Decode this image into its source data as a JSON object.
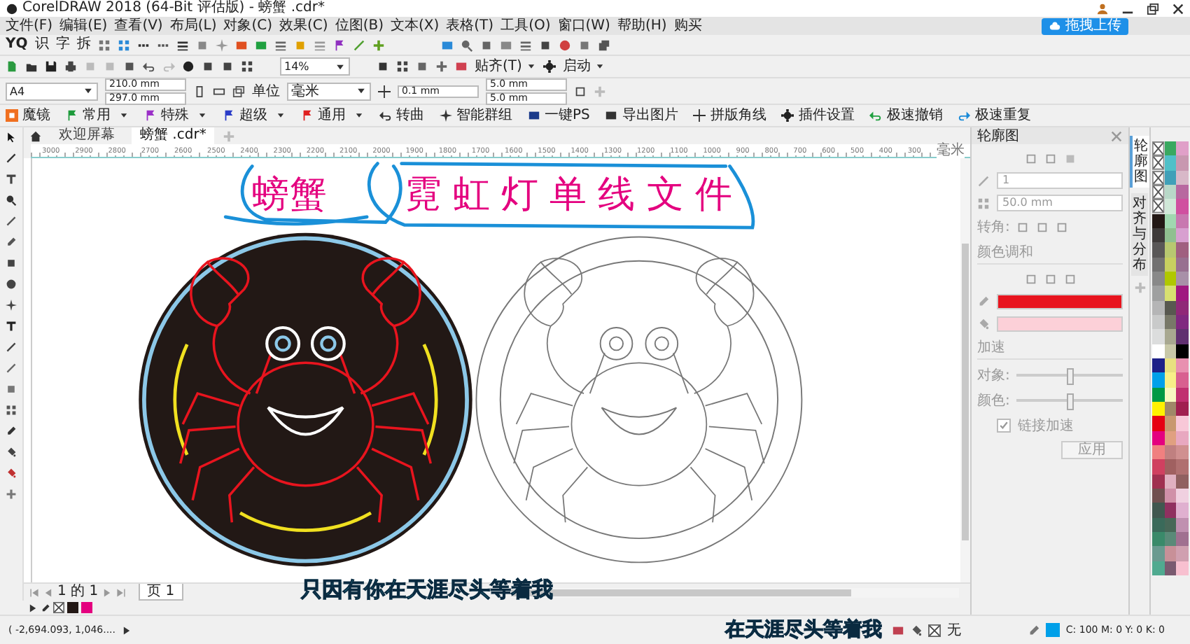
{
  "window": {
    "title": "CorelDRAW 2018 (64-Bit 评估版) - 螃蟹 .cdr*"
  },
  "menu": [
    "文件(F)",
    "编辑(E)",
    "查看(V)",
    "布局(L)",
    "对象(C)",
    "效果(C)",
    "位图(B)",
    "文本(X)",
    "表格(T)",
    "工具(O)",
    "窗口(W)",
    "帮助(H)",
    "购买"
  ],
  "upload_button": "拖拽上传",
  "text_tools": [
    "YQ",
    "识",
    "字",
    "拆"
  ],
  "standard_toolbar": {
    "zoom": "14%",
    "snap": "贴齐(T)",
    "launch": "启动"
  },
  "property_bar": {
    "page_size": "A4",
    "width": "210.0 mm",
    "height": "297.0 mm",
    "units_label": "单位",
    "units": "毫米",
    "nudge": "0.1 mm",
    "dup_x": "5.0 mm",
    "dup_y": "5.0 mm"
  },
  "plugin_bar": [
    {
      "kind": "app",
      "label": "魔镜"
    },
    {
      "kind": "menu",
      "label": "常用",
      "color": "#1e9b3c"
    },
    {
      "kind": "menu",
      "label": "特殊",
      "color": "#9b30c8"
    },
    {
      "kind": "menu",
      "label": "超级",
      "color": "#2a3cc8"
    },
    {
      "kind": "menu",
      "label": "通用",
      "color": "#e02020"
    },
    {
      "kind": "action",
      "label": "转曲"
    },
    {
      "kind": "action",
      "label": "智能群组"
    },
    {
      "kind": "action",
      "label": "一键PS"
    },
    {
      "kind": "action",
      "label": "导出图片"
    },
    {
      "kind": "action",
      "label": "拼版角线"
    },
    {
      "kind": "action",
      "label": "插件设置"
    },
    {
      "kind": "action",
      "label": "极速撤销"
    },
    {
      "kind": "action",
      "label": "极速重复"
    }
  ],
  "document_tabs": [
    {
      "label": "欢迎屏幕",
      "selected": false
    },
    {
      "label": "螃蟹 .cdr*",
      "selected": true
    }
  ],
  "ruler": {
    "labels": [
      "3000",
      "2900",
      "2800",
      "2700",
      "2600",
      "2500",
      "2400",
      "2300",
      "2200",
      "2100",
      "2000",
      "1900",
      "1800",
      "1700",
      "1600",
      "1500",
      "1400",
      "1300",
      "1200",
      "1100",
      "1000",
      "900",
      "800",
      "700",
      "600",
      "500",
      "400",
      "300"
    ],
    "unit": "毫米"
  },
  "canvas": {
    "title": [
      "螃蟹",
      "霓虹灯单线文件"
    ]
  },
  "page_nav": {
    "position": "1 的 1",
    "page_tab": "页 1"
  },
  "subtitles": [
    "只因有你在天涯尽头等着我",
    "在天涯尽头等着我"
  ],
  "document_palette": [
    {
      "kind": "none"
    },
    {
      "kind": "swatch",
      "color": "#231815"
    },
    {
      "kind": "swatch",
      "color": "#e4007f"
    }
  ],
  "status_bar": {
    "coords": "( -2,694.093, 1,046....",
    "fill": "无",
    "outline": {
      "color": "#00a0e9"
    },
    "color_values": "C: 100 M: 0 Y: 0 K: 0"
  },
  "docker": {
    "title": "轮廓图",
    "disabled": true,
    "steps": "1",
    "offset": "50.0 mm",
    "corner_label": "转角:",
    "blend_label": "颜色调和",
    "outline": {
      "color": "#e8141e"
    },
    "fill": {
      "color": "#fcd0d8"
    },
    "accel_label": "加速",
    "sliders": [
      {
        "label": "对象:",
        "level": 0.5
      },
      {
        "label": "颜色:",
        "level": 0.5
      }
    ],
    "link": {
      "label": "链接加速",
      "checked": true
    },
    "apply": "应用"
  },
  "docker_tabs": [
    {
      "label": "轮廓图",
      "selected": true
    },
    {
      "label": "对齐与分布",
      "selected": false
    }
  ],
  "palette": [
    [
      {
        "kind": "none"
      },
      {
        "kind": "none"
      },
      {
        "kind": "none"
      },
      {
        "kind": "none"
      },
      {
        "kind": "none"
      },
      {
        "kind": "swatch",
        "color": "#231815"
      },
      {
        "kind": "swatch",
        "color": "#3e3a39"
      },
      {
        "kind": "swatch",
        "color": "#595757"
      },
      {
        "kind": "swatch",
        "color": "#727171"
      },
      {
        "kind": "swatch",
        "color": "#898989"
      },
      {
        "kind": "swatch",
        "color": "#9fa0a0"
      },
      {
        "kind": "swatch",
        "color": "#b5b5b6"
      },
      {
        "kind": "swatch",
        "color": "#c9caca"
      },
      {
        "kind": "swatch",
        "color": "#dcdddd"
      },
      {
        "kind": "swatch",
        "color": "#ffffff"
      },
      {
        "kind": "swatch",
        "color": "#1d2088"
      },
      {
        "kind": "swatch",
        "color": "#00a0e9"
      },
      {
        "kind": "swatch",
        "color": "#009944"
      },
      {
        "kind": "swatch",
        "color": "#fff100"
      },
      {
        "kind": "swatch",
        "color": "#e60012"
      },
      {
        "kind": "swatch",
        "color": "#e4007f"
      },
      {
        "kind": "swatch",
        "color": "#f08080"
      },
      {
        "kind": "swatch",
        "color": "#d04060"
      },
      {
        "kind": "swatch",
        "color": "#a03050"
      },
      {
        "kind": "swatch",
        "color": "#705050"
      },
      {
        "kind": "swatch",
        "color": "#405850"
      },
      {
        "kind": "swatch",
        "color": "#3a6a5a"
      },
      {
        "kind": "swatch",
        "color": "#3a8a6a"
      },
      {
        "kind": "swatch",
        "color": "#6a9a90"
      },
      {
        "kind": "swatch",
        "color": "#50aa90"
      }
    ],
    [
      {
        "kind": "swatch",
        "color": "#3aa860"
      },
      {
        "kind": "swatch",
        "color": "#50c0c8"
      },
      {
        "kind": "swatch",
        "color": "#40a0b8"
      },
      {
        "kind": "swatch",
        "color": "#b8d8c8"
      },
      {
        "kind": "swatch",
        "color": "#d0e8d8"
      },
      {
        "kind": "swatch",
        "color": "#a0d8b0"
      },
      {
        "kind": "swatch",
        "color": "#90c090"
      },
      {
        "kind": "swatch",
        "color": "#b8c870"
      },
      {
        "kind": "swatch",
        "color": "#c8d060"
      },
      {
        "kind": "swatch",
        "color": "#b0c800"
      },
      {
        "kind": "swatch",
        "color": "#d8e070"
      },
      {
        "kind": "swatch",
        "color": "#585850"
      },
      {
        "kind": "swatch",
        "color": "#787868"
      },
      {
        "kind": "swatch",
        "color": "#a8a890"
      },
      {
        "kind": "swatch",
        "color": "#c8c8a8"
      },
      {
        "kind": "swatch",
        "color": "#e8e080"
      },
      {
        "kind": "swatch",
        "color": "#f8f088"
      },
      {
        "kind": "swatch",
        "color": "#f8f8c0"
      },
      {
        "kind": "swatch",
        "color": "#a08868"
      },
      {
        "kind": "swatch",
        "color": "#c89870"
      },
      {
        "kind": "swatch",
        "color": "#e0a080"
      },
      {
        "kind": "swatch",
        "color": "#c08080"
      },
      {
        "kind": "swatch",
        "color": "#a06060"
      },
      {
        "kind": "swatch",
        "color": "#e0b0c0"
      },
      {
        "kind": "swatch",
        "color": "#d090a8"
      },
      {
        "kind": "swatch",
        "color": "#903060"
      },
      {
        "kind": "swatch",
        "color": "#486858"
      },
      {
        "kind": "swatch",
        "color": "#5a8a78"
      },
      {
        "kind": "swatch",
        "color": "#c89098"
      },
      {
        "kind": "swatch",
        "color": "#7a5a70"
      }
    ],
    [
      {
        "kind": "swatch",
        "color": "#e0a0c8"
      },
      {
        "kind": "swatch",
        "color": "#c898b0"
      },
      {
        "kind": "swatch",
        "color": "#d8b8c8"
      },
      {
        "kind": "swatch",
        "color": "#b868a0"
      },
      {
        "kind": "swatch",
        "color": "#d050a0"
      },
      {
        "kind": "swatch",
        "color": "#c878b0"
      },
      {
        "kind": "swatch",
        "color": "#d8a0d0"
      },
      {
        "kind": "swatch",
        "color": "#a06080"
      },
      {
        "kind": "swatch",
        "color": "#987090"
      },
      {
        "kind": "swatch",
        "color": "#a890a8"
      },
      {
        "kind": "swatch",
        "color": "#a01880"
      },
      {
        "kind": "swatch",
        "color": "#902878"
      },
      {
        "kind": "swatch",
        "color": "#802880"
      },
      {
        "kind": "swatch",
        "color": "#603070"
      },
      {
        "kind": "swatch",
        "color": "#000000"
      },
      {
        "kind": "swatch",
        "color": "#e890b0"
      },
      {
        "kind": "swatch",
        "color": "#d86090"
      },
      {
        "kind": "swatch",
        "color": "#c03070"
      },
      {
        "kind": "swatch",
        "color": "#a02050"
      },
      {
        "kind": "swatch",
        "color": "#f8c8d8"
      },
      {
        "kind": "swatch",
        "color": "#e8a8c0"
      },
      {
        "kind": "swatch",
        "color": "#d09090"
      },
      {
        "kind": "swatch",
        "color": "#b07070"
      },
      {
        "kind": "swatch",
        "color": "#906060"
      },
      {
        "kind": "swatch",
        "color": "#f0d0e0"
      },
      {
        "kind": "swatch",
        "color": "#e0b0d0"
      },
      {
        "kind": "swatch",
        "color": "#c090b0"
      },
      {
        "kind": "swatch",
        "color": "#a07090"
      },
      {
        "kind": "swatch",
        "color": "#d0a0b0"
      },
      {
        "kind": "swatch",
        "color": "#f8c0d0"
      }
    ]
  ]
}
